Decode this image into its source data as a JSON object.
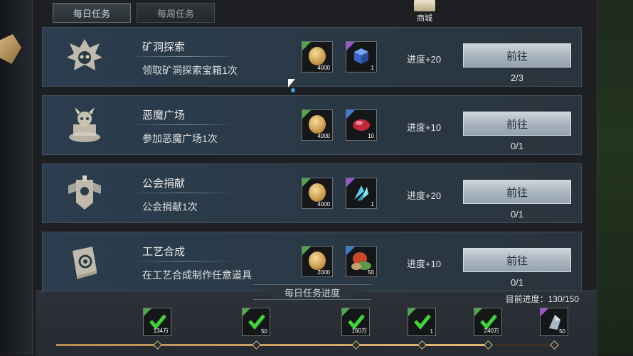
{
  "tabs": [
    {
      "label": "每日任务",
      "active": true
    },
    {
      "label": "每周任务",
      "active": false
    }
  ],
  "shop": {
    "label": "商城",
    "icon": "shop-chest-icon"
  },
  "tasks": [
    {
      "name": "矿洞探索",
      "desc": "领取矿洞探索宝箱1次",
      "emblem": "skull-emblem-icon",
      "rewards": [
        {
          "icon": "gold-coin-icon",
          "qty": "4000",
          "rarity": "green"
        },
        {
          "icon": "blue-cube-icon",
          "qty": "1",
          "rarity": "purple"
        }
      ],
      "progress_label": "进度+20",
      "button_label": "前往",
      "count": "2/3"
    },
    {
      "name": "恶魔广场",
      "desc": "参加恶魔广场1次",
      "emblem": "demon-altar-icon",
      "rewards": [
        {
          "icon": "gold-coin-icon",
          "qty": "4000",
          "rarity": "green"
        },
        {
          "icon": "red-gem-icon",
          "qty": "10",
          "rarity": "blue"
        }
      ],
      "progress_label": "进度+10",
      "button_label": "前往",
      "count": "0/1"
    },
    {
      "name": "公会捐献",
      "desc": "公会捐献1次",
      "emblem": "guild-banner-icon",
      "rewards": [
        {
          "icon": "gold-coin-icon",
          "qty": "4000",
          "rarity": "green"
        },
        {
          "icon": "crystal-shard-icon",
          "qty": "1",
          "rarity": "purple"
        }
      ],
      "progress_label": "进度+20",
      "button_label": "前往",
      "count": "0/1"
    },
    {
      "name": "工艺合成",
      "desc": "在工艺合成制作任意道具",
      "emblem": "craft-book-icon",
      "rewards": [
        {
          "icon": "gold-coin-icon",
          "qty": "2000",
          "rarity": "green"
        },
        {
          "icon": "material-pile-icon",
          "qty": "50",
          "rarity": "blue"
        }
      ],
      "progress_label": "进度+10",
      "button_label": "前往",
      "count": "0/1"
    }
  ],
  "daily_progress": {
    "title": "每日任务进度",
    "current_label": "目前进度：130/150",
    "current": 130,
    "max": 150,
    "milestones": [
      {
        "qty": "134万",
        "claimed": true,
        "rarity": "green"
      },
      {
        "qty": "50",
        "claimed": true,
        "rarity": "green"
      },
      {
        "qty": "160万",
        "claimed": true,
        "rarity": "green"
      },
      {
        "qty": "1",
        "claimed": true,
        "rarity": "green"
      },
      {
        "qty": "240万",
        "claimed": true,
        "rarity": "green"
      },
      {
        "qty": "50",
        "claimed": false,
        "rarity": "purple"
      }
    ]
  }
}
